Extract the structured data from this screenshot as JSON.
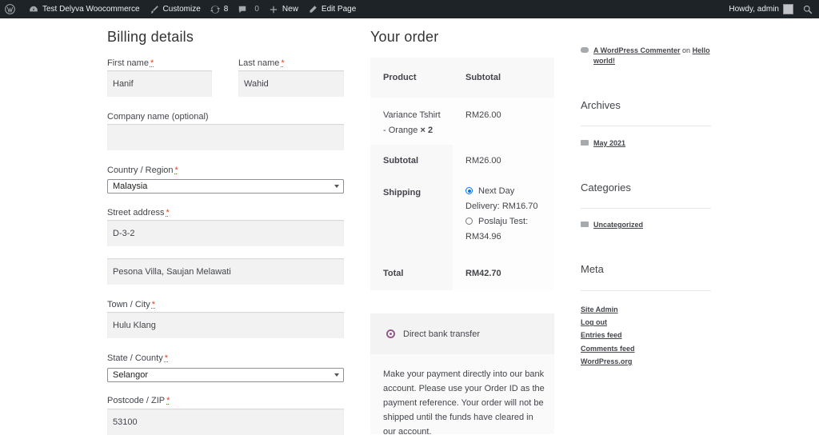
{
  "adminbar": {
    "site_name": "Test Delyva Woocommerce",
    "customize": "Customize",
    "updates_count": "8",
    "comments_count": "0",
    "new": "New",
    "edit_page": "Edit Page",
    "howdy": "Howdy, admin"
  },
  "billing": {
    "title": "Billing details",
    "first_name_label": "First name",
    "first_name_value": "Hanif",
    "last_name_label": "Last name",
    "last_name_value": "Wahid",
    "company_label": "Company name (optional)",
    "company_value": "",
    "country_label": "Country / Region",
    "country_value": "Malaysia",
    "street_label": "Street address",
    "street1_value": "D-3-2",
    "street2_value": "Pesona Villa, Saujan Melawati",
    "city_label": "Town / City",
    "city_value": "Hulu Klang",
    "state_label": "State / County",
    "state_value": "Selangor",
    "postcode_label": "Postcode / ZIP",
    "postcode_value": "53100",
    "required_mark": "*"
  },
  "order": {
    "title": "Your order",
    "header_product": "Product",
    "header_subtotal": "Subtotal",
    "item_name_line1": "Variance Tshirt",
    "item_name_line2": "- Orange",
    "item_qty": "× 2",
    "item_price": "RM26.00",
    "subtotal_label": "Subtotal",
    "subtotal_value": "RM26.00",
    "shipping_label": "Shipping",
    "shipping_option1_line1": "Next Day",
    "shipping_option1_line2": "Delivery: RM16.70",
    "shipping_option2_line1": "Poslaju Test:",
    "shipping_option2_line2": "RM34.96",
    "total_label": "Total",
    "total_value": "RM42.70",
    "payment_method": "Direct bank transfer",
    "payment_desc_lines": [
      "Make your payment directly into our bank",
      "account. Please use your Order ID as the",
      "payment reference. Your order will not be",
      "shipped until the funds have cleared in",
      "our account."
    ]
  },
  "sidebar": {
    "comment_author": "A WordPress Commenter",
    "comment_on": "on",
    "comment_post_line1": "Hello",
    "comment_post_line2": "world!",
    "archives_title": "Archives",
    "archive_item": "May 2021",
    "categories_title": "Categories",
    "category_item": "Uncategorized",
    "meta_title": "Meta",
    "meta_links": [
      "Site Admin",
      "Log out",
      "Entries feed",
      "Comments feed",
      "WordPress.org"
    ]
  },
  "colors": {
    "adminbar_bg": "#1d2327",
    "input_bg": "#f2f2f2",
    "required": "#e2401c",
    "payment_accent": "#96588a",
    "radio_selected": "#0075ff"
  }
}
